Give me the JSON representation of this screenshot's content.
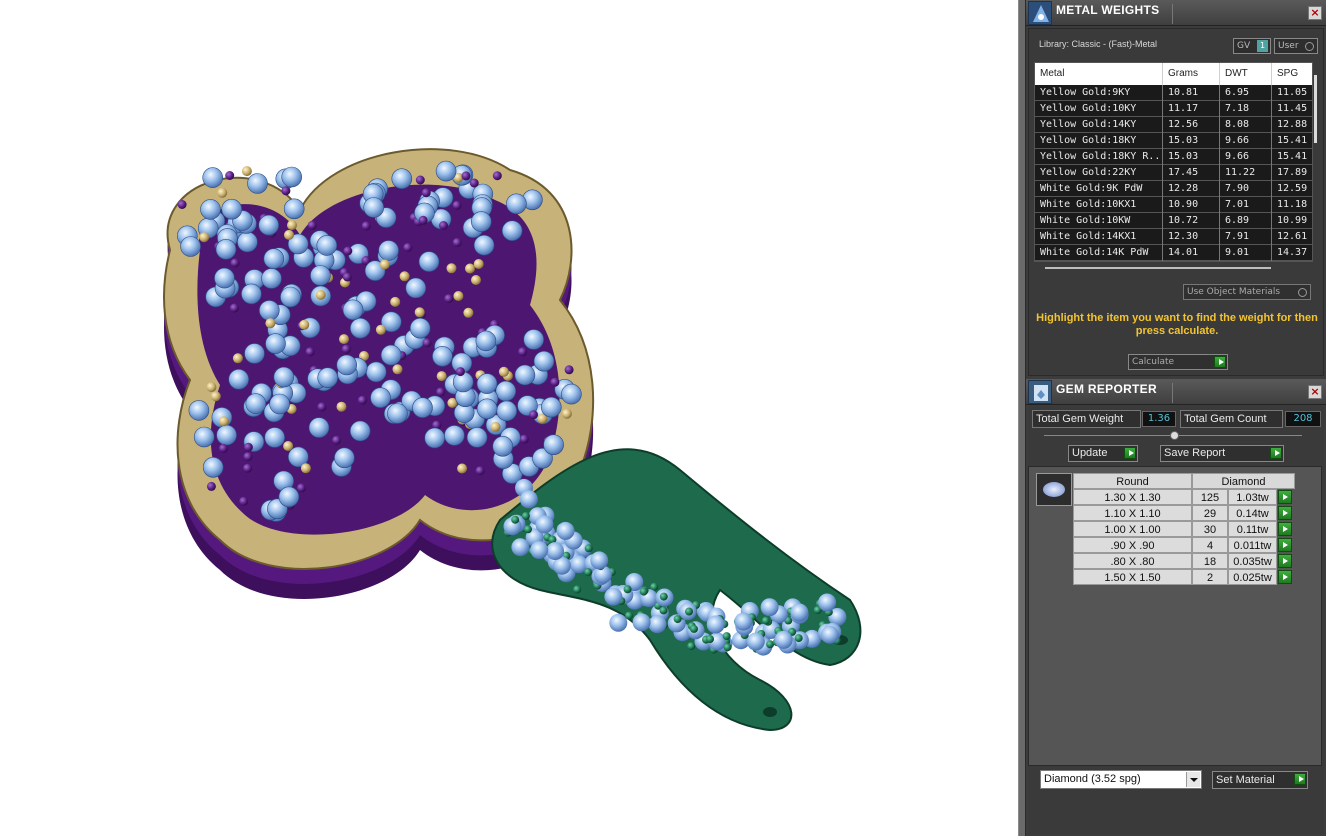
{
  "metal_weights": {
    "title": "METAL WEIGHTS",
    "library_label": "Library: Classic - (Fast)-Metal",
    "gv_label": "GV",
    "gv_value": "1",
    "user_label": "User",
    "columns": [
      "Metal",
      "Grams",
      "DWT",
      "SPG"
    ],
    "rows": [
      {
        "metal": "Yellow Gold:9KY",
        "grams": "10.81",
        "dwt": "6.95",
        "spg": "11.05"
      },
      {
        "metal": "Yellow Gold:10KY",
        "grams": "11.17",
        "dwt": "7.18",
        "spg": "11.45"
      },
      {
        "metal": "Yellow Gold:14KY",
        "grams": "12.56",
        "dwt": "8.08",
        "spg": "12.88"
      },
      {
        "metal": "Yellow Gold:18KY",
        "grams": "15.03",
        "dwt": "9.66",
        "spg": "15.41"
      },
      {
        "metal": "Yellow Gold:18KY R...",
        "grams": "15.03",
        "dwt": "9.66",
        "spg": "15.41"
      },
      {
        "metal": "Yellow Gold:22KY",
        "grams": "17.45",
        "dwt": "11.22",
        "spg": "17.89"
      },
      {
        "metal": "White Gold:9K PdW",
        "grams": "12.28",
        "dwt": "7.90",
        "spg": "12.59"
      },
      {
        "metal": "White Gold:10KX1",
        "grams": "10.90",
        "dwt": "7.01",
        "spg": "11.18"
      },
      {
        "metal": "White Gold:10KW",
        "grams": "10.72",
        "dwt": "6.89",
        "spg": "10.99"
      },
      {
        "metal": "White Gold:14KX1",
        "grams": "12.30",
        "dwt": "7.91",
        "spg": "12.61"
      },
      {
        "metal": "White Gold:14K PdW",
        "grams": "14.01",
        "dwt": "9.01",
        "spg": "14.37"
      }
    ],
    "use_object_materials": "Use Object Materials",
    "hint_text": "Highlight the item you want to find the weight for then press calculate.",
    "calculate_label": "Calculate"
  },
  "gem_reporter": {
    "title": "GEM REPORTER",
    "total_weight_label": "Total Gem Weight",
    "total_weight_value": "1.36",
    "total_count_label": "Total Gem Count",
    "total_count_value": "208",
    "update_label": "Update",
    "save_report_label": "Save Report",
    "shape_header": "Round",
    "type_header": "Diamond",
    "rows": [
      {
        "size": "1.30 X 1.30",
        "count": "125",
        "weight": "1.03tw"
      },
      {
        "size": "1.10 X 1.10",
        "count": "29",
        "weight": "0.14tw"
      },
      {
        "size": "1.00 X 1.00",
        "count": "30",
        "weight": "0.11tw"
      },
      {
        "size": ".90 X .90",
        "count": "4",
        "weight": "0.011tw"
      },
      {
        "size": ".80 X .80",
        "count": "18",
        "weight": "0.035tw"
      },
      {
        "size": "1.50 X 1.50",
        "count": "2",
        "weight": "0.025tw"
      }
    ],
    "material_select": "Diamond    (3.52 spg)",
    "set_material_label": "Set Material"
  },
  "colors": {
    "gold": "#c8b27a",
    "purple": "#4b1a6e",
    "green": "#1f6b4f",
    "gem_blue": "#9cc1ec",
    "hint_yellow": "#f3c431"
  }
}
